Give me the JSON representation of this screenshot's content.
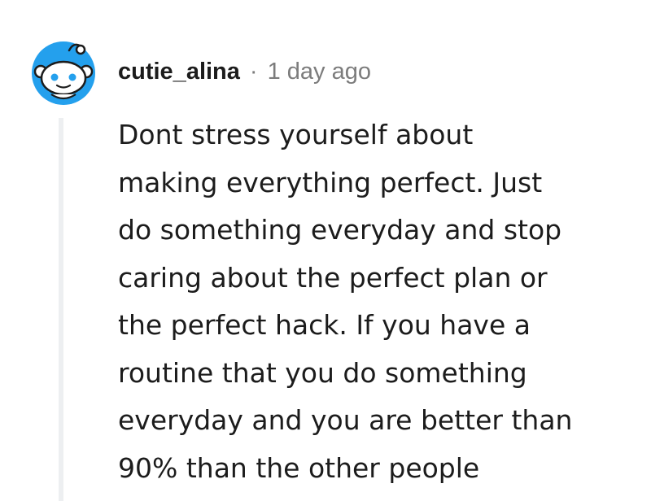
{
  "comment": {
    "username": "cutie_alina",
    "separator": "·",
    "timestamp": "1 day ago",
    "avatar_icon": "snoo-avatar-icon",
    "body_lines": [
      "Dont stress yourself about",
      "making everything perfect. Just",
      "do something everyday and stop",
      "caring about the perfect plan or",
      "the perfect hack. If you have a",
      "routine that you do something",
      "everyday and you are better than",
      "90% than the other people"
    ]
  },
  "colors": {
    "avatar_bg": "#24a0ed",
    "username": "#1c1c1c",
    "meta": "#7c7c7c",
    "thread_line": "#edeff1",
    "text": "#1c1c1c"
  }
}
